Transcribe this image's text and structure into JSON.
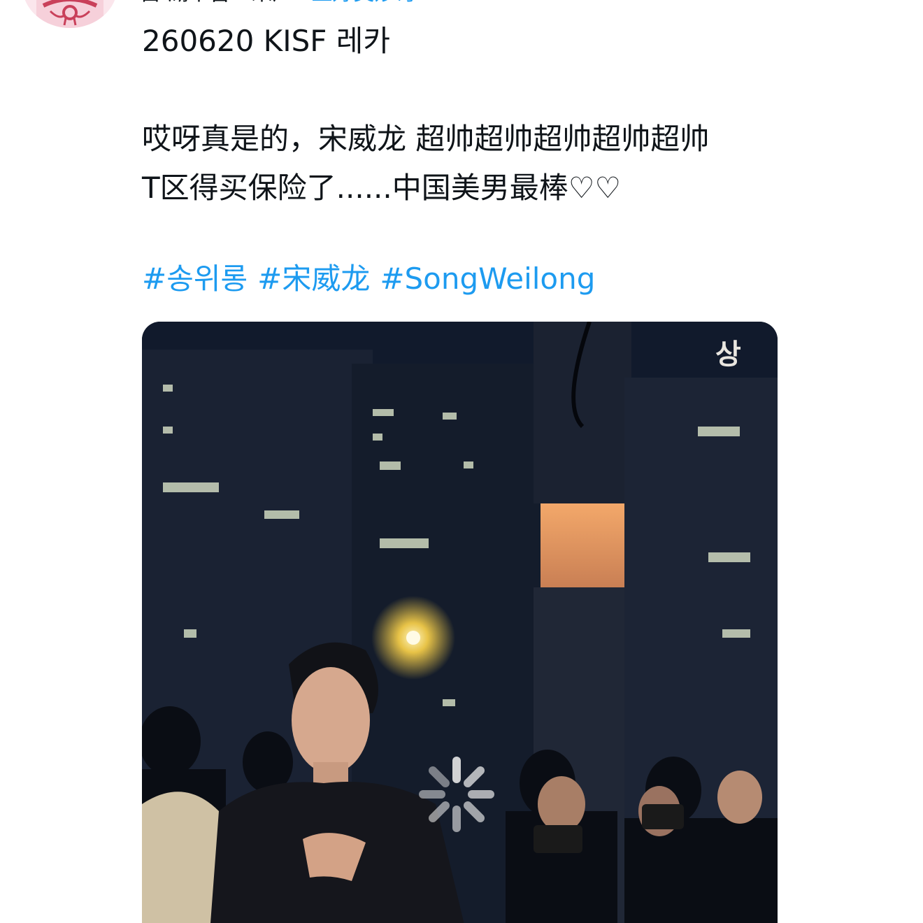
{
  "author": {
    "name": "自·湖华吉一来厂",
    "handle": "上好美妙奇"
  },
  "tweet": {
    "line1": "260620 KISF 레카",
    "line2": "哎呀真是的，宋威龙 超帅超帅超帅超帅超帅",
    "line3": "T区得买保险了......中国美男最棒♡♡"
  },
  "hashtags": [
    "#송위롱",
    "#宋威龙",
    "#SongWeilong"
  ],
  "media": {
    "building_sign": "상",
    "state": "loading",
    "loading_icon": "spinner-icon"
  },
  "colors": {
    "link": "#1d9bf0",
    "text": "#0f1419",
    "background": "#ffffff"
  }
}
